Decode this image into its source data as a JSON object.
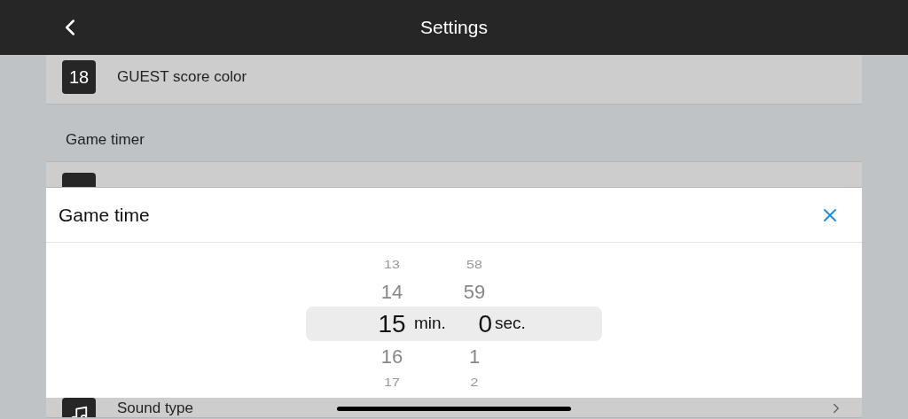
{
  "header": {
    "title": "Settings"
  },
  "rows_top": [
    {
      "kind": "number",
      "badge": "18",
      "label": "GUEST score color"
    }
  ],
  "section": {
    "title": "Game timer"
  },
  "rows_section": [
    {
      "kind": "blank"
    }
  ],
  "dialog": {
    "title": "Game time",
    "picker": {
      "minutes_label": "min.",
      "seconds_label": "sec.",
      "minutes": [
        {
          "value": "13",
          "selected": false
        },
        {
          "value": "14",
          "selected": false
        },
        {
          "value": "15",
          "selected": true
        },
        {
          "value": "16",
          "selected": false
        },
        {
          "value": "17",
          "selected": false
        }
      ],
      "seconds": [
        {
          "value": "58",
          "selected": false
        },
        {
          "value": "59",
          "selected": false
        },
        {
          "value": "0",
          "selected": true
        },
        {
          "value": "1",
          "selected": false
        },
        {
          "value": "2",
          "selected": false
        }
      ]
    }
  },
  "rows_bottom": [
    {
      "kind": "icon",
      "label": "Sound type",
      "chevron": true
    }
  ]
}
